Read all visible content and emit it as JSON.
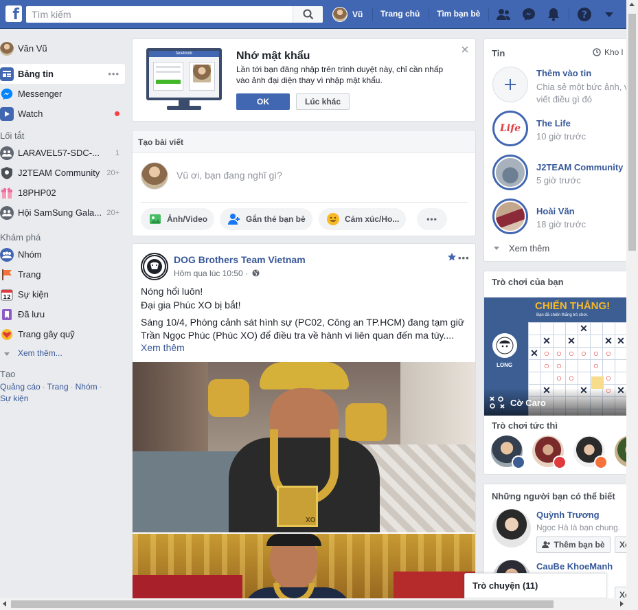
{
  "colors": {
    "brand": "#4267b2",
    "link": "#385898",
    "badge_red": "#fa3e3e"
  },
  "header": {
    "search_placeholder": "Tìm kiếm",
    "profile_name": "Vũ",
    "home_link": "Trang chủ",
    "find_friends_link": "Tìm bạn bè",
    "icons": [
      "friend-requests-icon",
      "messenger-icon",
      "notifications-icon",
      "help-icon",
      "dropdown-icon"
    ]
  },
  "left_nav": {
    "profile_name": "Văn Vũ",
    "main_items": [
      {
        "label": "Bảng tin",
        "icon": "news-feed-icon"
      },
      {
        "label": "Messenger",
        "icon": "messenger-icon"
      },
      {
        "label": "Watch",
        "icon": "watch-icon"
      }
    ],
    "shortcuts_heading": "Lối tắt",
    "shortcuts": [
      {
        "label": "LARAVEL57-SDC-...",
        "count": "1"
      },
      {
        "label": "J2TEAM Community",
        "count": "20+"
      },
      {
        "label": "18PHP02",
        "count": ""
      },
      {
        "label": "Hội SamSung Gala...",
        "count": "20+"
      }
    ],
    "explore_heading": "Khám phá",
    "explore": [
      {
        "label": "Nhóm",
        "icon": "groups-icon"
      },
      {
        "label": "Trang",
        "icon": "pages-flag-icon"
      },
      {
        "label": "Sự kiện",
        "icon": "events-calendar-icon"
      },
      {
        "label": "Đã lưu",
        "icon": "saved-icon"
      },
      {
        "label": "Trang gây quỹ",
        "icon": "fundraiser-icon"
      }
    ],
    "see_more": "Xem thêm...",
    "create_heading": "Tạo",
    "create_links": [
      "Quảng cáo",
      "Trang",
      "Nhóm",
      "Sự kiện"
    ]
  },
  "remember_password": {
    "title": "Nhớ mật khẩu",
    "body": "Lần tới bạn đăng nhập trên trình duyệt này, chỉ cần nhấp vào ảnh đại diện thay vì nhập mật khẩu.",
    "ok_button": "OK",
    "later_button": "Lúc khác",
    "illustration_brand": "facebook"
  },
  "composer": {
    "heading": "Tạo bài viết",
    "placeholder": "Vũ ơi, bạn đang nghĩ gì?",
    "actions": [
      "Ảnh/Video",
      "Gắn thẻ bạn bè",
      "Cảm xúc/Ho..."
    ]
  },
  "post": {
    "author": "DOG Brothers Team Vietnam",
    "time": "Hôm qua lúc 10:50 ·",
    "line1": "Nóng hổi luôn!",
    "line2": "Đại gia Phúc XO bị bắt!",
    "text": "Sáng 10/4, Phòng cảnh sát hình sự (PC02, Công an TP.HCM) đang tạm giữ Trần Ngọc Phúc (Phúc XO) để điều tra về hành vi liên quan đến ma túy....",
    "see_more": "Xem thêm",
    "pendant_text": "XO"
  },
  "stories": {
    "heading": "Tin",
    "archive_link": "Kho l",
    "add_title": "Thêm vào tin",
    "add_sub": "Chia sẻ một bức ảnh, v viết điều gì đó",
    "items": [
      {
        "name": "The Life",
        "time": "10 giờ trước",
        "logo_text": "Life"
      },
      {
        "name": "J2TEAM Community",
        "time": "5 giờ trước"
      },
      {
        "name": "Hoài Văn",
        "time": "18 giờ trước"
      }
    ],
    "see_more": "Xem thêm"
  },
  "games": {
    "heading": "Trò chơi của bạn",
    "banner_title": "CHIẾN THẮNG!",
    "banner_sub": "Bạn đã chiến thắng trò chơi.",
    "player_name": "LONG",
    "game_name": "Cờ Caro",
    "instant_heading": "Trò chơi tức thì"
  },
  "people": {
    "heading": "Những người bạn có thể biết",
    "items": [
      {
        "name": "Quỳnh Trương",
        "mutual": "Ngọc Hà là bạn chung.",
        "add_button": "Thêm bạn bè",
        "remove_button": "Xó"
      },
      {
        "name": "CauBe KhoeManh",
        "remove_button": "Xó"
      }
    ]
  },
  "chat": {
    "label": "Trò chuyện (11)"
  }
}
